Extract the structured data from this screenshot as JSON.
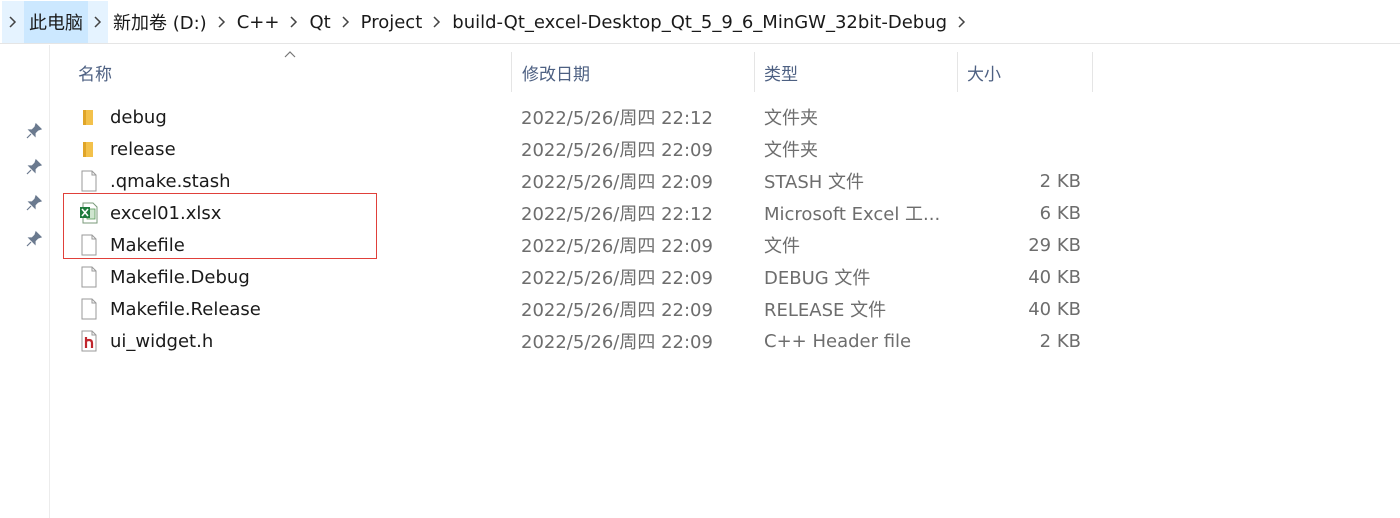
{
  "breadcrumb": [
    "此电脑",
    "新加卷 (D:)",
    "C++",
    "Qt",
    "Project",
    "build-Qt_excel-Desktop_Qt_5_9_6_MinGW_32bit-Debug"
  ],
  "columns": {
    "name": "名称",
    "date": "修改日期",
    "type": "类型",
    "size": "大小"
  },
  "files": [
    {
      "name": "debug",
      "date": "2022/5/26/周四 22:12",
      "type": "文件夹",
      "size": "",
      "icon": "folder-icon"
    },
    {
      "name": "release",
      "date": "2022/5/26/周四 22:09",
      "type": "文件夹",
      "size": "",
      "icon": "folder-icon"
    },
    {
      "name": ".qmake.stash",
      "date": "2022/5/26/周四 22:09",
      "type": "STASH 文件",
      "size": "2 KB",
      "icon": "file-icon"
    },
    {
      "name": "excel01.xlsx",
      "date": "2022/5/26/周四 22:12",
      "type": "Microsoft Excel 工...",
      "size": "6 KB",
      "icon": "excel-file-icon"
    },
    {
      "name": "Makefile",
      "date": "2022/5/26/周四 22:09",
      "type": "文件",
      "size": "29 KB",
      "icon": "file-icon"
    },
    {
      "name": "Makefile.Debug",
      "date": "2022/5/26/周四 22:09",
      "type": "DEBUG 文件",
      "size": "40 KB",
      "icon": "file-icon"
    },
    {
      "name": "Makefile.Release",
      "date": "2022/5/26/周四 22:09",
      "type": "RELEASE 文件",
      "size": "40 KB",
      "icon": "file-icon"
    },
    {
      "name": "ui_widget.h",
      "date": "2022/5/26/周四 22:09",
      "type": "C++ Header file",
      "size": "2 KB",
      "icon": "header-file-icon"
    }
  ],
  "colors": {
    "accent_selected": "#cce8ff",
    "highlight_box": "#e0403a",
    "folder": "#f3c14b"
  }
}
